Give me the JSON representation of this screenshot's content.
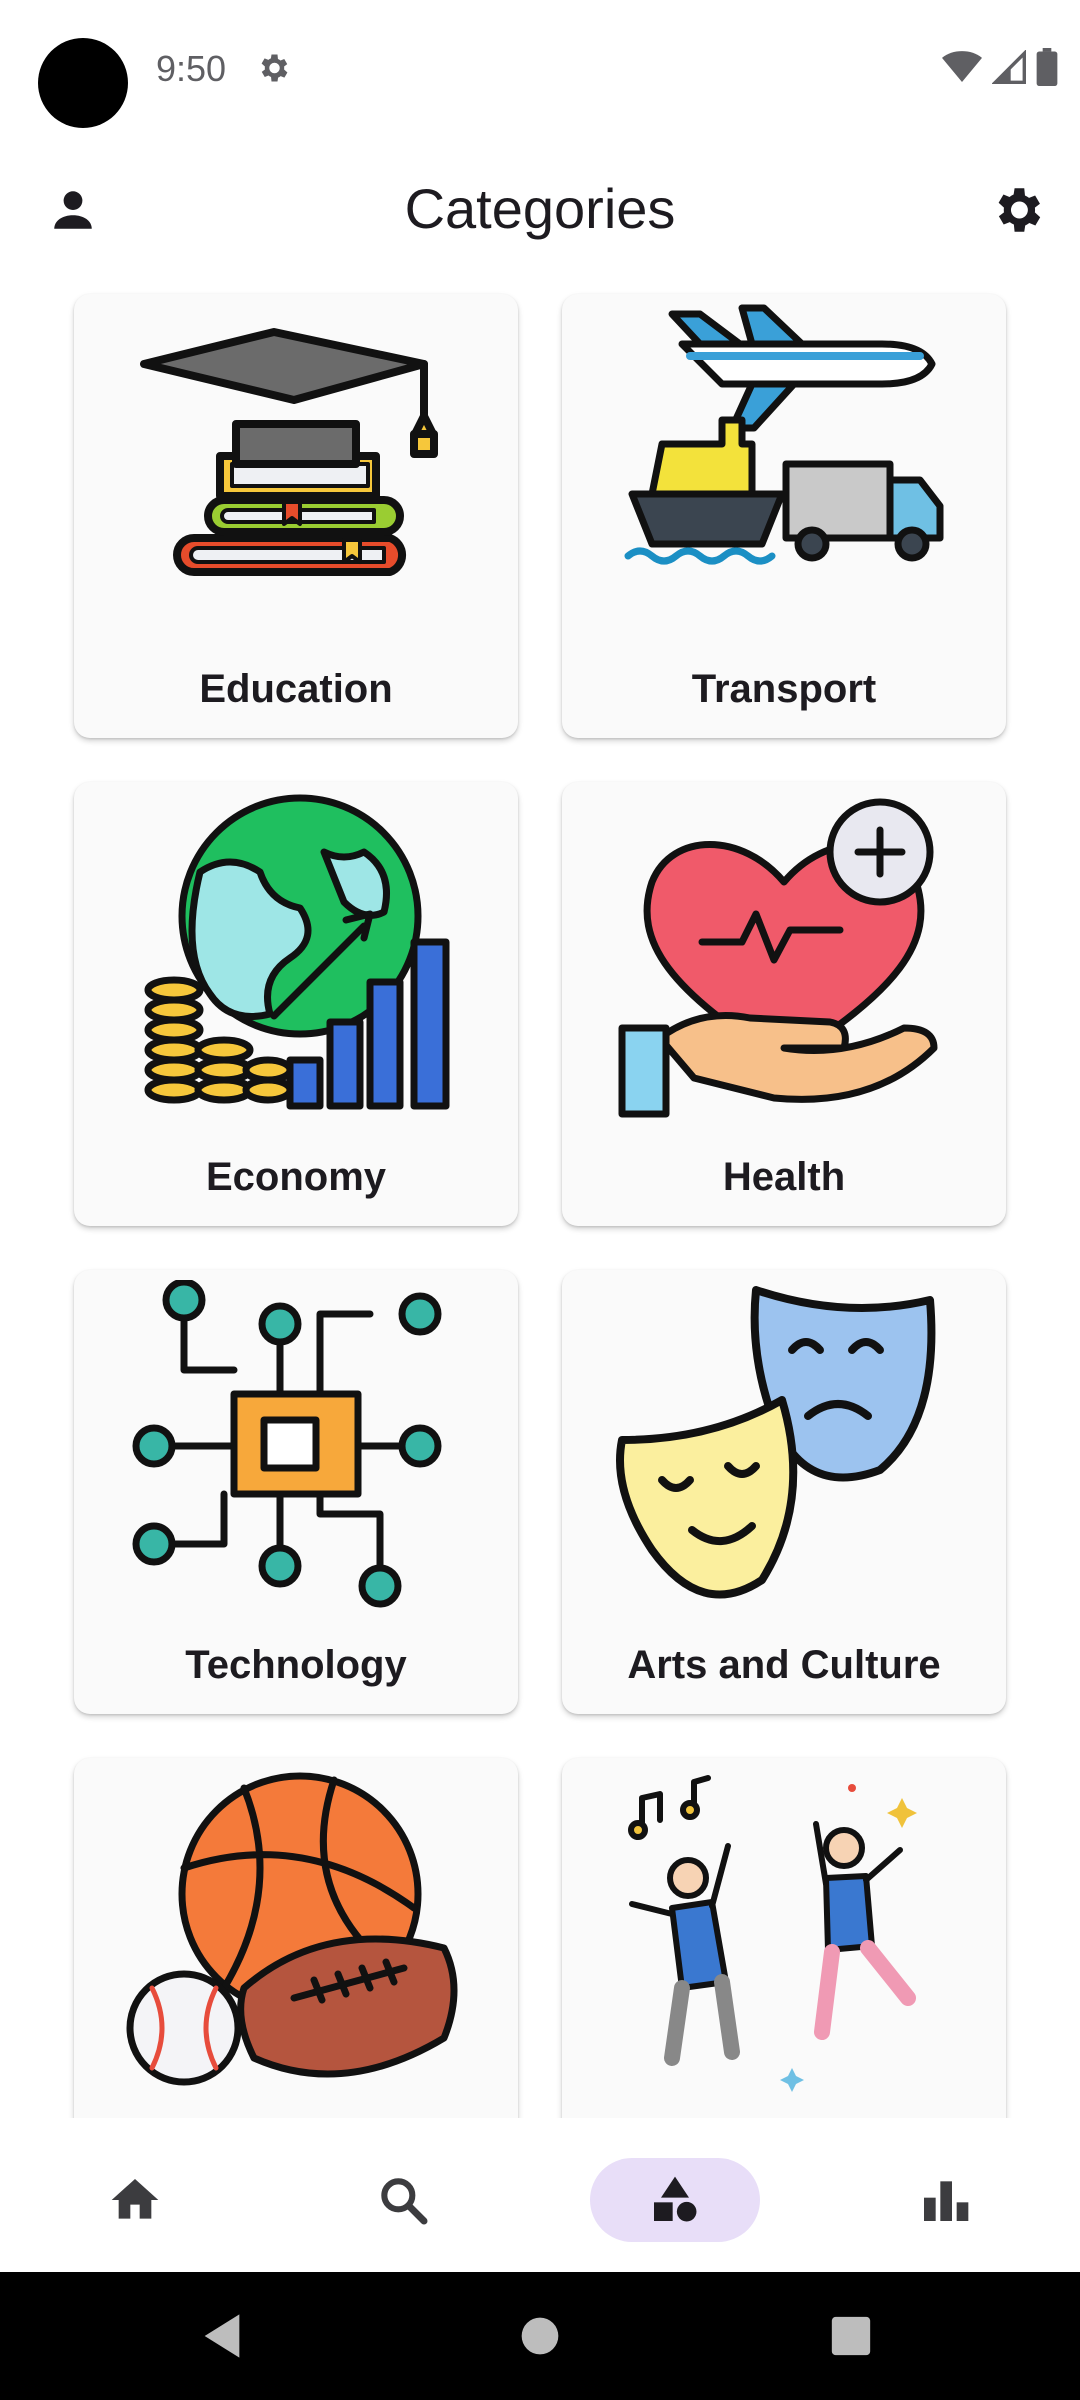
{
  "status_bar": {
    "time": "9:50"
  },
  "app_bar": {
    "title": "Categories"
  },
  "categories": [
    {
      "label": "Education"
    },
    {
      "label": "Transport"
    },
    {
      "label": "Economy"
    },
    {
      "label": "Health"
    },
    {
      "label": "Technology"
    },
    {
      "label": "Arts and Culture"
    },
    {
      "label": ""
    },
    {
      "label": ""
    }
  ],
  "bottom_nav": {
    "items": [
      {
        "icon": "home-icon"
      },
      {
        "icon": "search-icon"
      },
      {
        "icon": "categories-icon",
        "active": true
      },
      {
        "icon": "bar-chart-icon"
      }
    ],
    "active_background": "#e8def8"
  },
  "colors": {
    "accent": "#e8def8",
    "text": "#1d1b20"
  }
}
